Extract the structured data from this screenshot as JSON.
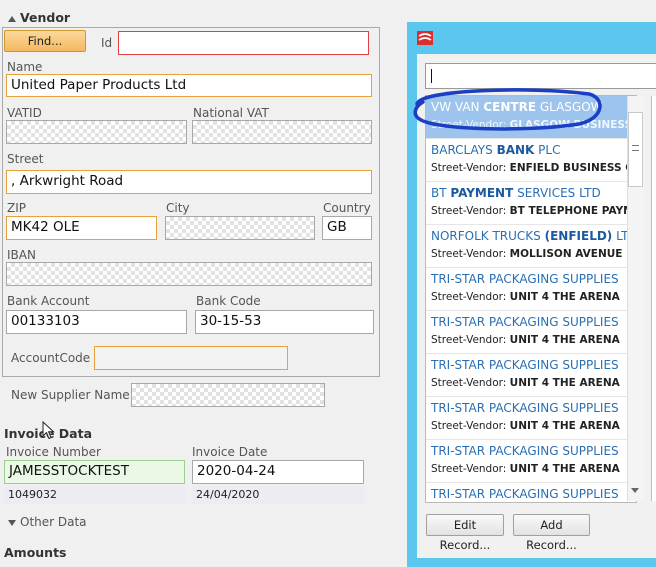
{
  "vendor": {
    "section_label": "Vendor",
    "find_label": "Find...",
    "id_label": "Id",
    "id_value": "",
    "name_label": "Name",
    "name_value": "United Paper Products Ltd",
    "vatid_label": "VATID",
    "national_vat_label": "National VAT",
    "street_label": "Street",
    "street_value": ", Arkwright Road",
    "zip_label": "ZIP",
    "zip_value": "MK42 OLE",
    "city_label": "City",
    "country_label": "Country",
    "country_value": "GB",
    "iban_label": "IBAN",
    "bank_account_label": "Bank Account",
    "bank_account_value": "00133103",
    "bank_code_label": "Bank Code",
    "bank_code_value": "30-15-53",
    "account_code_label": "AccountCode",
    "account_code_value": ""
  },
  "new_supplier": {
    "label": "New Supplier Name",
    "value": ""
  },
  "invoice": {
    "section_label": "Invoice Data",
    "number_label": "Invoice Number",
    "number_value": "JAMESSTOCKTEST",
    "number_extracted": "1049032",
    "date_label": "Invoice Date",
    "date_value": "2020-04-24",
    "date_extracted": "24/04/2020"
  },
  "other_data_label": "Other Data",
  "amounts_label": "Amounts",
  "popup": {
    "search_value": "",
    "items": [
      {
        "name_pre": "VW VAN ",
        "name_bold": "CENTRE",
        "name_post": " GLASGOW",
        "street_prefix": "Street-Vendor: ",
        "street_value": "GLASGOW BUSINESS PARK",
        "selected": true
      },
      {
        "name_pre": "BARCLAYS ",
        "name_bold": "BANK",
        "name_post": " PLC",
        "street_prefix": "Street-Vendor: ",
        "street_value": "ENFIELD BUSINESS CENTRE",
        "selected": false
      },
      {
        "name_pre": "BT ",
        "name_bold": "PAYMENT",
        "name_post": " SERVICES LTD",
        "street_prefix": "Street-Vendor: ",
        "street_value": "BT TELEPHONE PAYMENTS",
        "selected": false
      },
      {
        "name_pre": "NORFOLK TRUCKS ",
        "name_bold": "(ENFIELD)",
        "name_post": " LTD",
        "street_prefix": "Street-Vendor: ",
        "street_value": "MOLLISON AVENUE",
        "selected": false
      },
      {
        "name_pre": "TRI-STAR PACKAGING SUPPLIES",
        "name_bold": "",
        "name_post": "",
        "street_prefix": "Street-Vendor: ",
        "street_value": "UNIT 4 THE ARENA",
        "selected": false
      },
      {
        "name_pre": "TRI-STAR PACKAGING SUPPLIES",
        "name_bold": "",
        "name_post": "",
        "street_prefix": "Street-Vendor: ",
        "street_value": "UNIT 4 THE ARENA",
        "selected": false
      },
      {
        "name_pre": "TRI-STAR PACKAGING SUPPLIES",
        "name_bold": "",
        "name_post": "",
        "street_prefix": "Street-Vendor: ",
        "street_value": "UNIT 4 THE ARENA",
        "selected": false
      },
      {
        "name_pre": "TRI-STAR PACKAGING SUPPLIES",
        "name_bold": "",
        "name_post": "",
        "street_prefix": "Street-Vendor: ",
        "street_value": "UNIT 4 THE ARENA",
        "selected": false
      },
      {
        "name_pre": "TRI-STAR PACKAGING SUPPLIES",
        "name_bold": "",
        "name_post": "",
        "street_prefix": "Street-Vendor: ",
        "street_value": "UNIT 4 THE ARENA",
        "selected": false
      },
      {
        "name_pre": "TRI-STAR PACKAGING SUPPLIES",
        "name_bold": "",
        "name_post": "",
        "street_prefix": "Street-Vendor: ",
        "street_value": "",
        "selected": false
      }
    ],
    "edit_record_label": "Edit Record...",
    "add_record_label": "Add Record..."
  },
  "colors": {
    "popup_frame": "#5bc7ef",
    "selection": "#9cc4ec",
    "highlight_ring": "#1a3fc4",
    "find_button": "#f4b860"
  }
}
